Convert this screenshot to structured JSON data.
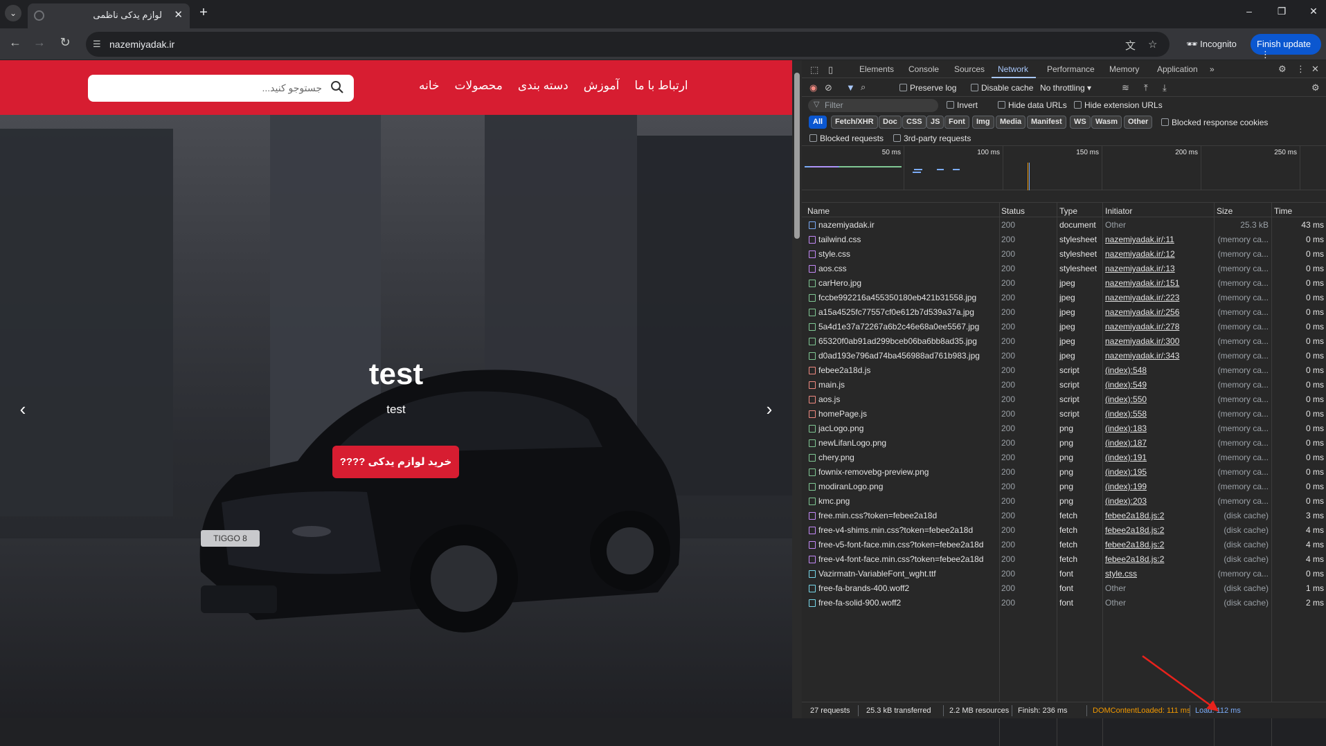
{
  "browser": {
    "tab_title": "لوازم یدکی ناظمی",
    "url": "nazemiyadak.ir",
    "incognito_label": "Incognito",
    "finish_update_label": "Finish update"
  },
  "site": {
    "search_placeholder": "جستوجو کنید...",
    "nav": [
      "خانه",
      "محصولات",
      "دسته بندی",
      "آموزش",
      "ارتباط با ما"
    ],
    "hero_title": "test",
    "hero_subtitle": "test",
    "cta_label": "خرید لوازم یدکی ????",
    "car_badge": "TIGGO 8"
  },
  "devtools": {
    "tabs": [
      "Elements",
      "Console",
      "Sources",
      "Network",
      "Performance",
      "Memory",
      "Application"
    ],
    "active_tab": "Network",
    "more_tabs": "»",
    "preserve_log": "Preserve log",
    "disable_cache": "Disable cache",
    "throttling": "No throttling",
    "filter_placeholder": "Filter",
    "invert": "Invert",
    "hide_data_urls": "Hide data URLs",
    "hide_extension_urls": "Hide extension URLs",
    "type_filters": [
      "All",
      "Fetch/XHR",
      "Doc",
      "CSS",
      "JS",
      "Font",
      "Img",
      "Media",
      "Manifest",
      "WS",
      "Wasm",
      "Other"
    ],
    "active_type": "All",
    "blocked_response_cookies": "Blocked response cookies",
    "blocked_requests": "Blocked requests",
    "third_party_requests": "3rd-party requests",
    "timeline_ticks": [
      "50 ms",
      "100 ms",
      "150 ms",
      "200 ms",
      "250 ms"
    ],
    "columns": [
      "Name",
      "Status",
      "Type",
      "Initiator",
      "Size",
      "Time"
    ],
    "requests": [
      {
        "name": "nazemiyadak.ir",
        "status": "200",
        "type": "document",
        "initiator": "Other",
        "size": "25.3 kB",
        "time": "43 ms",
        "kind": "doc",
        "init_link": false
      },
      {
        "name": "tailwind.css",
        "status": "200",
        "type": "stylesheet",
        "initiator": "nazemiyadak.ir/:11",
        "size": "(memory ca...",
        "time": "0 ms",
        "kind": "css",
        "init_link": true
      },
      {
        "name": "style.css",
        "status": "200",
        "type": "stylesheet",
        "initiator": "nazemiyadak.ir/:12",
        "size": "(memory ca...",
        "time": "0 ms",
        "kind": "css",
        "init_link": true
      },
      {
        "name": "aos.css",
        "status": "200",
        "type": "stylesheet",
        "initiator": "nazemiyadak.ir/:13",
        "size": "(memory ca...",
        "time": "0 ms",
        "kind": "css",
        "init_link": true
      },
      {
        "name": "carHero.jpg",
        "status": "200",
        "type": "jpeg",
        "initiator": "nazemiyadak.ir/:151",
        "size": "(memory ca...",
        "time": "0 ms",
        "kind": "img",
        "init_link": true
      },
      {
        "name": "fccbe992216a455350180eb421b31558.jpg",
        "status": "200",
        "type": "jpeg",
        "initiator": "nazemiyadak.ir/:223",
        "size": "(memory ca...",
        "time": "0 ms",
        "kind": "img",
        "init_link": true
      },
      {
        "name": "a15a4525fc77557cf0e612b7d539a37a.jpg",
        "status": "200",
        "type": "jpeg",
        "initiator": "nazemiyadak.ir/:256",
        "size": "(memory ca...",
        "time": "0 ms",
        "kind": "img",
        "init_link": true
      },
      {
        "name": "5a4d1e37a72267a6b2c46e68a0ee5567.jpg",
        "status": "200",
        "type": "jpeg",
        "initiator": "nazemiyadak.ir/:278",
        "size": "(memory ca...",
        "time": "0 ms",
        "kind": "img",
        "init_link": true
      },
      {
        "name": "65320f0ab91ad299bceb06ba6bb8ad35.jpg",
        "status": "200",
        "type": "jpeg",
        "initiator": "nazemiyadak.ir/:300",
        "size": "(memory ca...",
        "time": "0 ms",
        "kind": "img",
        "init_link": true
      },
      {
        "name": "d0ad193e796ad74ba456988ad761b983.jpg",
        "status": "200",
        "type": "jpeg",
        "initiator": "nazemiyadak.ir/:343",
        "size": "(memory ca...",
        "time": "0 ms",
        "kind": "img",
        "init_link": true
      },
      {
        "name": "febee2a18d.js",
        "status": "200",
        "type": "script",
        "initiator": "(index):548",
        "size": "(memory ca...",
        "time": "0 ms",
        "kind": "js",
        "init_link": true
      },
      {
        "name": "main.js",
        "status": "200",
        "type": "script",
        "initiator": "(index):549",
        "size": "(memory ca...",
        "time": "0 ms",
        "kind": "js",
        "init_link": true
      },
      {
        "name": "aos.js",
        "status": "200",
        "type": "script",
        "initiator": "(index):550",
        "size": "(memory ca...",
        "time": "0 ms",
        "kind": "js",
        "init_link": true
      },
      {
        "name": "homePage.js",
        "status": "200",
        "type": "script",
        "initiator": "(index):558",
        "size": "(memory ca...",
        "time": "0 ms",
        "kind": "js",
        "init_link": true
      },
      {
        "name": "jacLogo.png",
        "status": "200",
        "type": "png",
        "initiator": "(index):183",
        "size": "(memory ca...",
        "time": "0 ms",
        "kind": "img",
        "init_link": true
      },
      {
        "name": "newLifanLogo.png",
        "status": "200",
        "type": "png",
        "initiator": "(index):187",
        "size": "(memory ca...",
        "time": "0 ms",
        "kind": "img",
        "init_link": true
      },
      {
        "name": "chery.png",
        "status": "200",
        "type": "png",
        "initiator": "(index):191",
        "size": "(memory ca...",
        "time": "0 ms",
        "kind": "img",
        "init_link": true
      },
      {
        "name": "fownix-removebg-preview.png",
        "status": "200",
        "type": "png",
        "initiator": "(index):195",
        "size": "(memory ca...",
        "time": "0 ms",
        "kind": "img",
        "init_link": true
      },
      {
        "name": "modiranLogo.png",
        "status": "200",
        "type": "png",
        "initiator": "(index):199",
        "size": "(memory ca...",
        "time": "0 ms",
        "kind": "img",
        "init_link": true
      },
      {
        "name": "kmc.png",
        "status": "200",
        "type": "png",
        "initiator": "(index):203",
        "size": "(memory ca...",
        "time": "0 ms",
        "kind": "img",
        "init_link": true
      },
      {
        "name": "free.min.css?token=febee2a18d",
        "status": "200",
        "type": "fetch",
        "initiator": "febee2a18d.js:2",
        "size": "(disk cache)",
        "time": "3 ms",
        "kind": "css",
        "init_link": true
      },
      {
        "name": "free-v4-shims.min.css?token=febee2a18d",
        "status": "200",
        "type": "fetch",
        "initiator": "febee2a18d.js:2",
        "size": "(disk cache)",
        "time": "4 ms",
        "kind": "css",
        "init_link": true
      },
      {
        "name": "free-v5-font-face.min.css?token=febee2a18d",
        "status": "200",
        "type": "fetch",
        "initiator": "febee2a18d.js:2",
        "size": "(disk cache)",
        "time": "4 ms",
        "kind": "css",
        "init_link": true
      },
      {
        "name": "free-v4-font-face.min.css?token=febee2a18d",
        "status": "200",
        "type": "fetch",
        "initiator": "febee2a18d.js:2",
        "size": "(disk cache)",
        "time": "4 ms",
        "kind": "css",
        "init_link": true
      },
      {
        "name": "Vazirmatn-VariableFont_wght.ttf",
        "status": "200",
        "type": "font",
        "initiator": "style.css",
        "size": "(memory ca...",
        "time": "0 ms",
        "kind": "font",
        "init_link": true
      },
      {
        "name": "free-fa-brands-400.woff2",
        "status": "200",
        "type": "font",
        "initiator": "Other",
        "size": "(disk cache)",
        "time": "1 ms",
        "kind": "font",
        "init_link": false
      },
      {
        "name": "free-fa-solid-900.woff2",
        "status": "200",
        "type": "font",
        "initiator": "Other",
        "size": "(disk cache)",
        "time": "2 ms",
        "kind": "font",
        "init_link": false
      }
    ],
    "status_bar": {
      "requests": "27 requests",
      "transferred": "25.3 kB transferred",
      "resources": "2.2 MB resources",
      "finish": "Finish: 236 ms",
      "dom_content_loaded": "DOMContentLoaded: 111 ms",
      "load": "Load: 112 ms"
    },
    "colors": {
      "dom_content_loaded": "#f29900",
      "load": "#7cacf8",
      "accent": "#a8c7fa",
      "annotation_arrow": "#e8221c"
    }
  }
}
